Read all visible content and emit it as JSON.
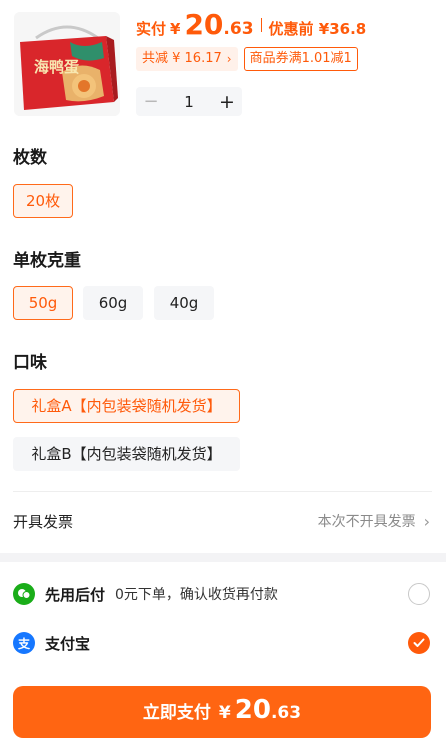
{
  "product": {
    "price_label": "实付",
    "currency": "¥",
    "price_int": "20",
    "price_dec": ".63",
    "original_price": "优惠前 ¥36.8",
    "reduction_tag": "共减 ¥ 16.17",
    "coupon_tag": "商品券满1.01减1",
    "quantity": "1",
    "image_text": "海鸭蛋"
  },
  "options": {
    "count": {
      "title": "枚数",
      "items": [
        {
          "label": "20枚",
          "selected": true
        }
      ]
    },
    "weight": {
      "title": "单枚克重",
      "items": [
        {
          "label": "50g",
          "selected": true
        },
        {
          "label": "60g",
          "selected": false
        },
        {
          "label": "40g",
          "selected": false
        }
      ]
    },
    "flavor": {
      "title": "口味",
      "items": [
        {
          "label": "礼盒A【内包装袋随机发货】",
          "selected": true
        },
        {
          "label": "礼盒B【内包装袋随机发货】",
          "selected": false
        }
      ]
    }
  },
  "invoice": {
    "label": "开具发票",
    "value": "本次不开具发票"
  },
  "payment": {
    "methods": [
      {
        "name": "先用后付",
        "desc": "0元下单，确认收货再付款",
        "icon": "wechat-pay-later-icon",
        "icon_color": "#1aad19",
        "selected": false
      },
      {
        "name": "支付宝",
        "desc": "",
        "icon": "alipay-icon",
        "icon_color": "#1677ff",
        "selected": true
      }
    ]
  },
  "pay_button": {
    "label": "立即支付",
    "currency": "¥",
    "amount_int": "20",
    "amount_dec": ".63"
  },
  "colors": {
    "accent": "#ff5a0a",
    "chip_bg": "#f5f6f8"
  }
}
